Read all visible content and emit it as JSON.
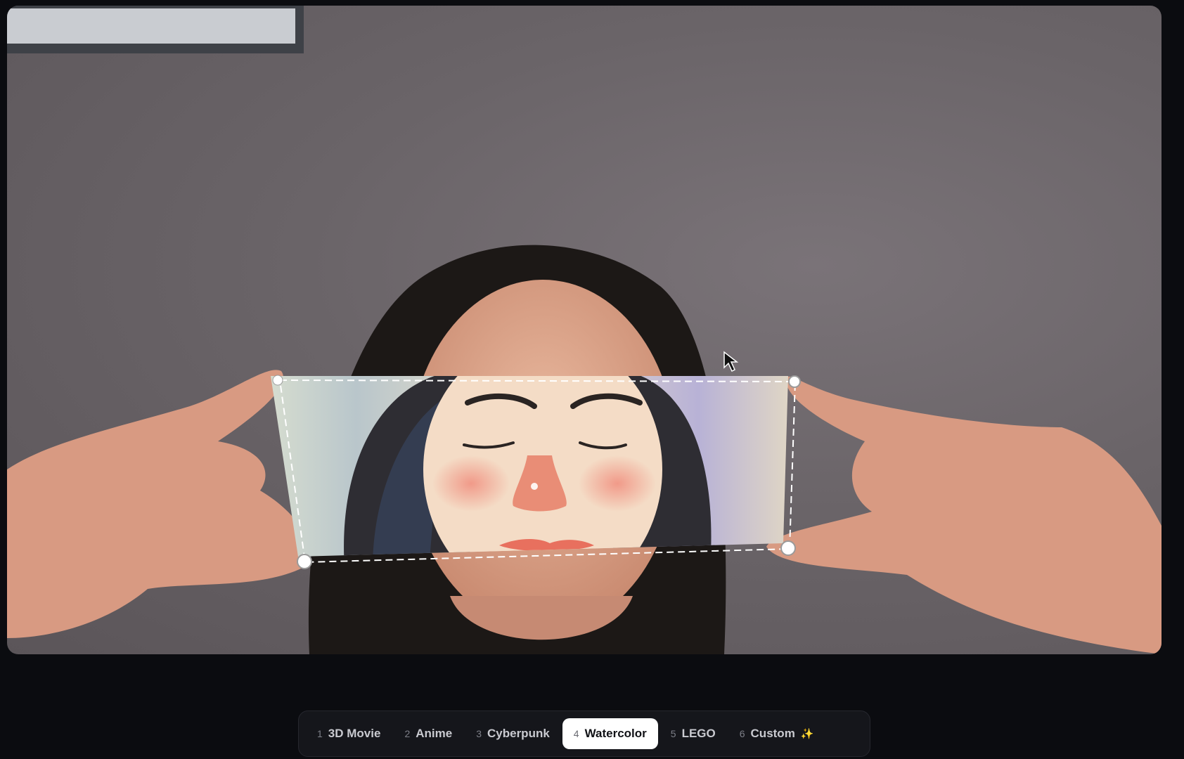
{
  "style_selector": {
    "tabs": [
      {
        "number": "1",
        "label": "3D Movie",
        "active": false
      },
      {
        "number": "2",
        "label": "Anime",
        "active": false
      },
      {
        "number": "3",
        "label": "Cyberpunk",
        "active": false
      },
      {
        "number": "4",
        "label": "Watercolor",
        "active": true
      },
      {
        "number": "5",
        "label": "LEGO",
        "active": false
      },
      {
        "number": "6",
        "label": "Custom",
        "active": false,
        "icon": "sparkle-icon"
      }
    ]
  },
  "colors": {
    "background": "#0b0c10",
    "active_tab": "#ffffff",
    "bar": "#15161b",
    "wall": "#6a6468",
    "skin": "#e0a58c",
    "hair": "#1a1716"
  }
}
